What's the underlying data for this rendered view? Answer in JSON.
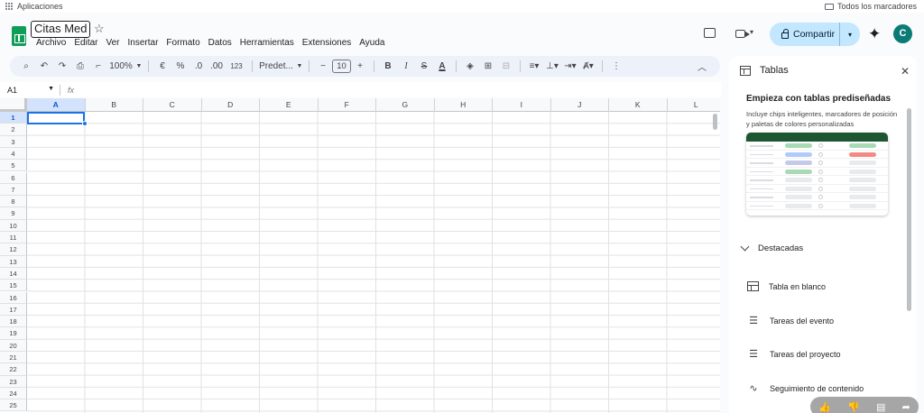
{
  "bookmarks": {
    "apps_label": "Aplicaciones",
    "all_label": "Todos los marcadores"
  },
  "title": {
    "doc_title": "Citas Med",
    "menu": [
      "Archivo",
      "Editar",
      "Ver",
      "Insertar",
      "Formato",
      "Datos",
      "Herramientas",
      "Extensiones",
      "Ayuda"
    ]
  },
  "header": {
    "share_label": "Compartir",
    "avatar_letter": "C"
  },
  "toolbar": {
    "zoom": "100%",
    "currency": "€",
    "percent": "%",
    "dec_minus": ".0",
    "dec_plus": ".00",
    "number_format": "123",
    "font": "Predet...",
    "font_size": "10",
    "minus": "−",
    "plus": "+",
    "bold": "B",
    "italic": "I",
    "strike": "S",
    "text_color": "A"
  },
  "namebar": {
    "cell_ref": "A1",
    "fx": "fx"
  },
  "grid": {
    "columns": [
      "A",
      "B",
      "C",
      "D",
      "E",
      "F",
      "G",
      "H",
      "I",
      "J",
      "K",
      "L"
    ],
    "rows": [
      "1",
      "2",
      "3",
      "4",
      "5",
      "6",
      "7",
      "8",
      "9",
      "10",
      "11",
      "12",
      "13",
      "14",
      "15",
      "16",
      "17",
      "18",
      "19",
      "20",
      "21",
      "22",
      "23",
      "24",
      "25"
    ],
    "selected_cell": "A1"
  },
  "panel": {
    "title": "Tablas",
    "heading": "Empieza con tablas prediseñadas",
    "description": "Incluye chips inteligentes, marcadores de posición y paletas de colores personalizadas",
    "section": "Destacadas",
    "items": [
      {
        "label": "Tabla en blanco",
        "icon": "table-icon"
      },
      {
        "label": "Tareas del evento",
        "icon": "checklist-icon"
      },
      {
        "label": "Tareas del proyecto",
        "icon": "checklist-icon"
      },
      {
        "label": "Seguimiento de contenido",
        "icon": "trend-icon"
      }
    ]
  },
  "colors": {
    "accent": "#1a73e8",
    "share_bg": "#c2e7ff",
    "sheets_green": "#0f9d58",
    "avatar": "#0b7b75"
  }
}
